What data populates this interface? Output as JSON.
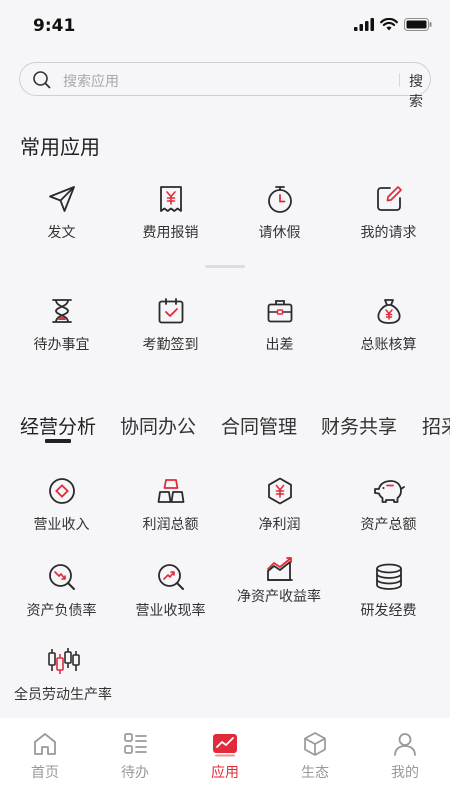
{
  "status": {
    "time": "9:41"
  },
  "search": {
    "placeholder": "搜索应用",
    "button": "搜索"
  },
  "common_apps": {
    "title": "常用应用",
    "row1": [
      {
        "label": "发文",
        "icon": "send-icon"
      },
      {
        "label": "费用报销",
        "icon": "receipt-icon"
      },
      {
        "label": "请休假",
        "icon": "stopwatch-icon"
      },
      {
        "label": "我的请求",
        "icon": "edit-icon"
      }
    ],
    "row2": [
      {
        "label": "待办事宜",
        "icon": "hourglass-icon"
      },
      {
        "label": "考勤签到",
        "icon": "calendar-check-icon"
      },
      {
        "label": "出差",
        "icon": "briefcase-icon"
      },
      {
        "label": "总账核算",
        "icon": "money-bag-icon"
      }
    ]
  },
  "tabs": [
    "经营分析",
    "协同办公",
    "合同管理",
    "财务共享",
    "招采"
  ],
  "metrics": {
    "row1": [
      {
        "label": "营业收入",
        "icon": "diamond-circle-icon"
      },
      {
        "label": "利润总额",
        "icon": "gold-bars-icon"
      },
      {
        "label": "净利润",
        "icon": "yen-hexagon-icon"
      },
      {
        "label": "资产总额",
        "icon": "piggy-bank-icon"
      }
    ],
    "row2": [
      {
        "label": "资产负债率",
        "icon": "trend-down-search-icon"
      },
      {
        "label": "营业收现率",
        "icon": "trend-up-search-icon"
      },
      {
        "label": "净资产收益率",
        "icon": "area-chart-icon"
      },
      {
        "label": "研发经费",
        "icon": "coin-stack-icon"
      }
    ],
    "row3": [
      {
        "label": "全员劳动生产率",
        "icon": "candlestick-icon"
      }
    ]
  },
  "bottom_nav": [
    {
      "label": "首页",
      "icon": "home-icon"
    },
    {
      "label": "待办",
      "icon": "todo-list-icon"
    },
    {
      "label": "应用",
      "icon": "apps-chart-icon"
    },
    {
      "label": "生态",
      "icon": "cube-icon"
    },
    {
      "label": "我的",
      "icon": "user-icon"
    }
  ],
  "colors": {
    "accent": "#e02b3b",
    "icon_dark": "#2b2b2b",
    "background": "#f6f6f8"
  }
}
